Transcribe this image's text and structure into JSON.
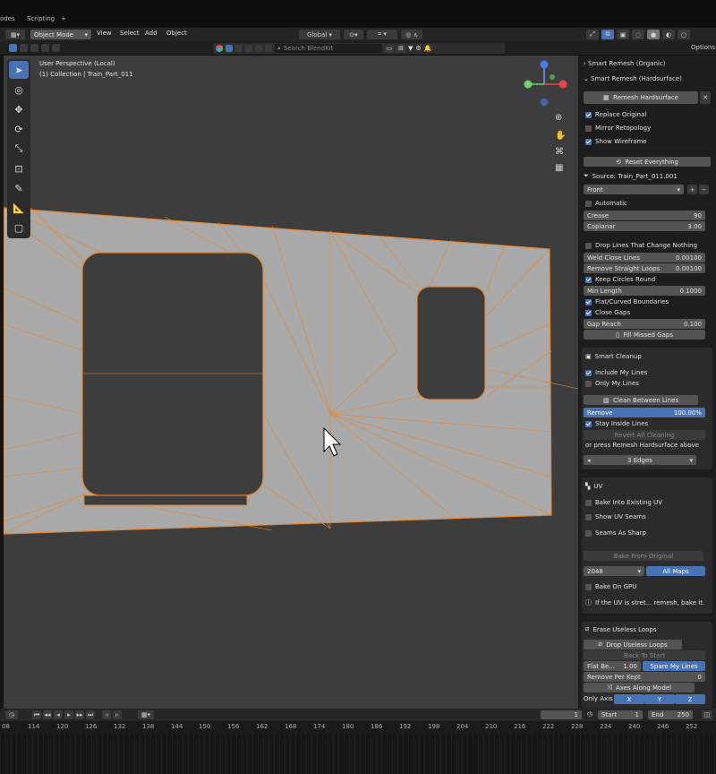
{
  "top": {
    "left_tab": "odes",
    "scripting_tab": "Scripting",
    "add_tab": "+"
  },
  "menu": {
    "mode": "Object Mode",
    "items": [
      "View",
      "Select",
      "Add",
      "Object"
    ],
    "transform": "Global",
    "search_placeholder": "Search BlendKit",
    "options": "Options"
  },
  "viewport": {
    "title": "User Perspective (Local)",
    "collection": "(1) Collection | Train_Part_011"
  },
  "panel": {
    "organic": "Smart Remesh (Organic)",
    "hardsurface": "Smart Remesh (Hardsurface)",
    "remesh_btn": "Remesh Hardsurface",
    "replace_original": "Replace Original",
    "mirror_retopology": "Mirror Retopology",
    "show_wireframe": "Show Wireframe",
    "reset_everything": "Reset Everything",
    "source": "Source: Train_Part_011.001",
    "view_dropdown": "Front",
    "automatic": "Automatic",
    "crease_label": "Crease",
    "crease_value": "90",
    "coplanar_label": "Coplanar",
    "coplanar_value": "3.00",
    "drop_lines": "Drop Lines That Change Nothing",
    "weld_label": "Weld Close Lines",
    "weld_value": "0.00100",
    "remove_straight_label": "Remove Straight Loops",
    "remove_straight_value": "0.00100",
    "keep_circles": "Keep Circles Round",
    "min_length_label": "Min Length",
    "min_length_value": "0.1000",
    "flat_curved": "Flat/Curved Boundaries",
    "close_gaps": "Close Gaps",
    "gap_reach_label": "Gap Reach",
    "gap_reach_value": "0.100",
    "fill_missed": "Fill Missed Gaps",
    "smart_cleanup": "Smart Cleanup",
    "include_my_lines": "Include My Lines",
    "only_my_lines": "Only My Lines",
    "clean_between": "Clean Between Lines",
    "remove_label": "Remove",
    "remove_value": "100.00%",
    "stay_inside": "Stay Inside Lines",
    "revert_all": "Revert All Cleaning",
    "press_remesh": "or press Remesh Hardsurface above",
    "edges_dropdown": "3 Edges",
    "uv_title": "UV",
    "bake_existing": "Bake Into Existing UV",
    "show_seams": "Show UV Seams",
    "seams_sharp": "Seams As Sharp",
    "bake_original": "Bake From Original",
    "res_dropdown": "2048",
    "all_maps": "All Maps",
    "bake_gpu": "Bake On GPU",
    "uv_info": "If the UV is stret... remesh, bake it.",
    "erase_title": "Erase Useless Loops",
    "drop_useless": "Drop Useless Loops",
    "back_to_start": "Back To Start",
    "flat_be_label": "Flat Be...",
    "flat_be_value": "1.00",
    "spare_lines": "Spare My Lines",
    "remove_per_kept_label": "Remove Per Kept",
    "remove_per_kept_value": "0",
    "axes_model": "Axes Along Model",
    "only_axis": "Only Axis",
    "axis_x": "X",
    "axis_y": "Y",
    "axis_z": "Z"
  },
  "timeline": {
    "frame": "1",
    "start_label": "Start",
    "start_value": "1",
    "end_label": "End",
    "end_value": "250",
    "ticks": [
      "08",
      "114",
      "120",
      "126",
      "132",
      "138",
      "144",
      "150",
      "156",
      "162",
      "168",
      "174",
      "180",
      "186",
      "192",
      "198",
      "204",
      "210",
      "216",
      "222",
      "228",
      "234",
      "240",
      "246",
      "252"
    ]
  },
  "colors": {
    "accent": "#4772b3",
    "wire": "#e8862f",
    "mesh": "#a9a9a9"
  }
}
